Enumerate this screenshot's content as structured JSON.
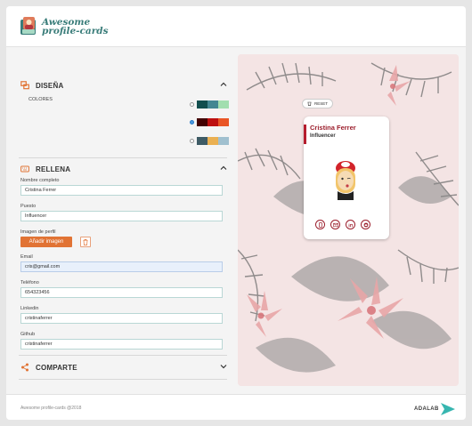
{
  "header": {
    "logo_line1": "Awesome",
    "logo_line2": "profile-cards"
  },
  "design": {
    "title": "DISEÑA",
    "colors_label": "COLORES",
    "palettes": [
      {
        "selected": false,
        "colors": [
          "#114e4e",
          "#438792",
          "#a2deaf"
        ]
      },
      {
        "selected": true,
        "colors": [
          "#420101",
          "#bd1010",
          "#e95626"
        ]
      },
      {
        "selected": false,
        "colors": [
          "#3e5b65",
          "#eab052",
          "#a0c0cf"
        ]
      }
    ]
  },
  "fill": {
    "title": "RELLENA",
    "name_label": "Nombre completo",
    "name_value": "Cristina Ferrer",
    "job_label": "Puesto",
    "job_value": "Influencer",
    "image_label": "Imagen de perfil",
    "add_image_label": "Añadir imagen",
    "email_label": "Email",
    "email_value": "cris@gmail.com",
    "phone_label": "Teléfono",
    "phone_value": "654323456",
    "linkedin_label": "Linkedin",
    "linkedin_value": "cristinaferrer",
    "github_label": "Github",
    "github_value": "cristinaferrer"
  },
  "share": {
    "title": "COMPARTE"
  },
  "preview": {
    "reset_label": "RESET",
    "card_name": "Cristina Ferrer",
    "card_job": "Influencer",
    "icons": [
      "phone-icon",
      "email-icon",
      "linkedin-icon",
      "github-icon"
    ],
    "accent": "#9b1d2b"
  },
  "footer": {
    "text": "Awesome profile-cards @2018",
    "brand": "ADALAB"
  }
}
